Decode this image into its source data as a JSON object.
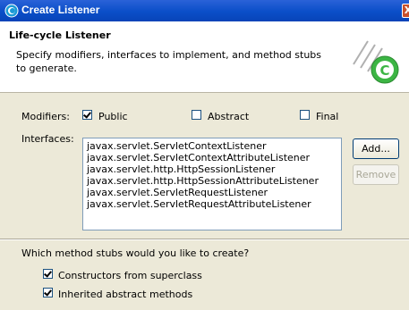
{
  "window": {
    "title": "Create Listener",
    "close_label": "X"
  },
  "banner": {
    "title": "Life-cycle Listener",
    "description": "Specify modifiers, interfaces to implement, and method stubs to generate."
  },
  "modifiers": {
    "label": "Modifiers:",
    "options": [
      {
        "label": "Public",
        "checked": true
      },
      {
        "label": "Abstract",
        "checked": false
      },
      {
        "label": "Final",
        "checked": false
      }
    ]
  },
  "interfaces": {
    "label": "Interfaces:",
    "items": [
      "javax.servlet.ServletContextListener",
      "javax.servlet.ServletContextAttributeListener",
      "javax.servlet.http.HttpSessionListener",
      "javax.servlet.http.HttpSessionAttributeListener",
      "javax.servlet.ServletRequestListener",
      "javax.servlet.ServletRequestAttributeListener"
    ],
    "add_label": "Add...",
    "remove_label": "Remove"
  },
  "stubs": {
    "question": "Which method stubs would you like to create?",
    "options": [
      {
        "label": "Constructors from superclass",
        "checked": true
      },
      {
        "label": "Inherited abstract methods",
        "checked": true
      }
    ]
  },
  "colors": {
    "titlebar": "#0a4ec8",
    "dialog_bg": "#ece9d8",
    "banner_bg": "#ffffff"
  }
}
